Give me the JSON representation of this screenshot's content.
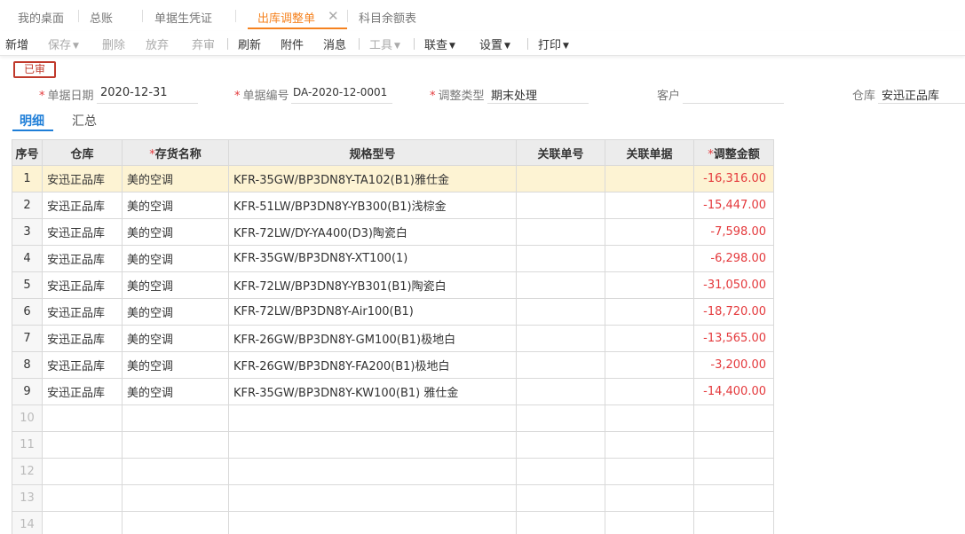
{
  "tabs": [
    {
      "label": "我的桌面"
    },
    {
      "label": "总账"
    },
    {
      "label": "单据生凭证"
    },
    {
      "label": "出库调整单"
    },
    {
      "label": "科目余额表"
    }
  ],
  "toolbar": {
    "new": "新增",
    "save": "保存",
    "delete": "删除",
    "discard": "放弃",
    "unaudit": "弃审",
    "refresh": "刷新",
    "attach": "附件",
    "message": "消息",
    "tools": "工具",
    "link": "联查",
    "settings": "设置",
    "print": "打印"
  },
  "status": "已审",
  "form": {
    "date_label": "单据日期",
    "date_value": "2020-12-31",
    "number_label": "单据编号",
    "number_value": "DA-2020-12-0001",
    "type_label": "调整类型",
    "type_value": "期末处理",
    "customer_label": "客户",
    "customer_value": "",
    "warehouse_label": "仓库",
    "warehouse_value": "安迅正品库"
  },
  "subtabs": {
    "detail": "明细",
    "summary": "汇总"
  },
  "table": {
    "headers": {
      "seq": "序号",
      "warehouse": "仓库",
      "item": "存货名称",
      "spec": "规格型号",
      "ref_no": "关联单号",
      "ref_doc": "关联单据",
      "amount": "调整金额"
    },
    "rows": [
      {
        "seq": "1",
        "warehouse": "安迅正品库",
        "item": "美的空调",
        "spec": "KFR-35GW/BP3DN8Y-TA102(B1)雅仕金",
        "ref_no": "",
        "ref_doc": "",
        "amount": "-16,316.00"
      },
      {
        "seq": "2",
        "warehouse": "安迅正品库",
        "item": "美的空调",
        "spec": "KFR-51LW/BP3DN8Y-YB300(B1)浅棕金",
        "ref_no": "",
        "ref_doc": "",
        "amount": "-15,447.00"
      },
      {
        "seq": "3",
        "warehouse": "安迅正品库",
        "item": "美的空调",
        "spec": "KFR-72LW/DY-YA400(D3)陶瓷白",
        "ref_no": "",
        "ref_doc": "",
        "amount": "-7,598.00"
      },
      {
        "seq": "4",
        "warehouse": "安迅正品库",
        "item": "美的空调",
        "spec": "KFR-35GW/BP3DN8Y-XT100(1)",
        "ref_no": "",
        "ref_doc": "",
        "amount": "-6,298.00"
      },
      {
        "seq": "5",
        "warehouse": "安迅正品库",
        "item": "美的空调",
        "spec": "KFR-72LW/BP3DN8Y-YB301(B1)陶瓷白",
        "ref_no": "",
        "ref_doc": "",
        "amount": "-31,050.00"
      },
      {
        "seq": "6",
        "warehouse": "安迅正品库",
        "item": "美的空调",
        "spec": "KFR-72LW/BP3DN8Y-Air100(B1)",
        "ref_no": "",
        "ref_doc": "",
        "amount": "-18,720.00"
      },
      {
        "seq": "7",
        "warehouse": "安迅正品库",
        "item": "美的空调",
        "spec": "KFR-26GW/BP3DN8Y-GM100(B1)极地白",
        "ref_no": "",
        "ref_doc": "",
        "amount": "-13,565.00"
      },
      {
        "seq": "8",
        "warehouse": "安迅正品库",
        "item": "美的空调",
        "spec": "KFR-26GW/BP3DN8Y-FA200(B1)极地白",
        "ref_no": "",
        "ref_doc": "",
        "amount": "-3,200.00"
      },
      {
        "seq": "9",
        "warehouse": "安迅正品库",
        "item": "美的空调",
        "spec": "KFR-35GW/BP3DN8Y-KW100(B1) 雅仕金",
        "ref_no": "",
        "ref_doc": "",
        "amount": "-14,400.00"
      },
      {
        "seq": "10",
        "warehouse": "",
        "item": "",
        "spec": "",
        "ref_no": "",
        "ref_doc": "",
        "amount": ""
      },
      {
        "seq": "11",
        "warehouse": "",
        "item": "",
        "spec": "",
        "ref_no": "",
        "ref_doc": "",
        "amount": ""
      },
      {
        "seq": "12",
        "warehouse": "",
        "item": "",
        "spec": "",
        "ref_no": "",
        "ref_doc": "",
        "amount": ""
      },
      {
        "seq": "13",
        "warehouse": "",
        "item": "",
        "spec": "",
        "ref_no": "",
        "ref_doc": "",
        "amount": ""
      },
      {
        "seq": "14",
        "warehouse": "",
        "item": "",
        "spec": "",
        "ref_no": "",
        "ref_doc": "",
        "amount": ""
      }
    ]
  },
  "colors": {
    "accent": "#f5821f",
    "link_blue": "#1e7ed8",
    "negative": "#e4393c",
    "selected_row": "#fdf3d3",
    "stamp": "#c0392b"
  }
}
